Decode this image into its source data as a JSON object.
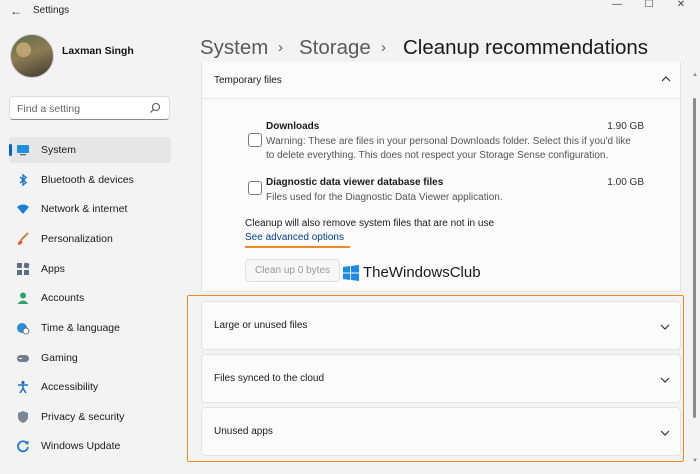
{
  "window": {
    "title": "Settings",
    "back_glyph": "←",
    "minimize_glyph": "—",
    "maximize_glyph": "☐",
    "close_glyph": "✕"
  },
  "user": {
    "name": "Laxman Singh"
  },
  "search": {
    "placeholder": "Find a setting",
    "value": ""
  },
  "sidebar": {
    "items": [
      {
        "label": "System",
        "icon": "monitor-icon",
        "active": true
      },
      {
        "label": "Bluetooth & devices",
        "icon": "bluetooth-icon"
      },
      {
        "label": "Network & internet",
        "icon": "wifi-icon"
      },
      {
        "label": "Personalization",
        "icon": "brush-icon"
      },
      {
        "label": "Apps",
        "icon": "apps-icon"
      },
      {
        "label": "Accounts",
        "icon": "person-icon"
      },
      {
        "label": "Time & language",
        "icon": "globe-clock-icon"
      },
      {
        "label": "Gaming",
        "icon": "gamepad-icon"
      },
      {
        "label": "Accessibility",
        "icon": "accessibility-icon"
      },
      {
        "label": "Privacy & security",
        "icon": "shield-icon"
      },
      {
        "label": "Windows Update",
        "icon": "update-icon"
      }
    ]
  },
  "breadcrumb": {
    "parts": [
      "System",
      "Storage",
      "Cleanup recommendations"
    ],
    "separator": "›"
  },
  "temporary_files": {
    "title": "Temporary files",
    "items": [
      {
        "name": "Downloads",
        "desc_line1": "Warning: These are files in your personal Downloads folder. Select this if you'd like",
        "desc_line2": "to delete everything. This does not respect your Storage Sense configuration.",
        "size": "1.90 GB",
        "checked": false
      },
      {
        "name": "Diagnostic data viewer database files",
        "desc_line1": "Files used for the Diagnostic Data Viewer application.",
        "size": "1.00 GB",
        "checked": false
      }
    ],
    "note": "Cleanup will also remove system files that are not in use",
    "advanced_link": "See advanced options",
    "cleanup_button": "Clean up 0 bytes"
  },
  "watermark": {
    "text": "TheWindowsClub"
  },
  "sections": [
    {
      "label": "Large or unused files"
    },
    {
      "label": "Files synced to the cloud"
    },
    {
      "label": "Unused apps"
    }
  ],
  "colors": {
    "accent": "#0067c0",
    "highlight": "#f08a24",
    "link": "#003e92"
  }
}
